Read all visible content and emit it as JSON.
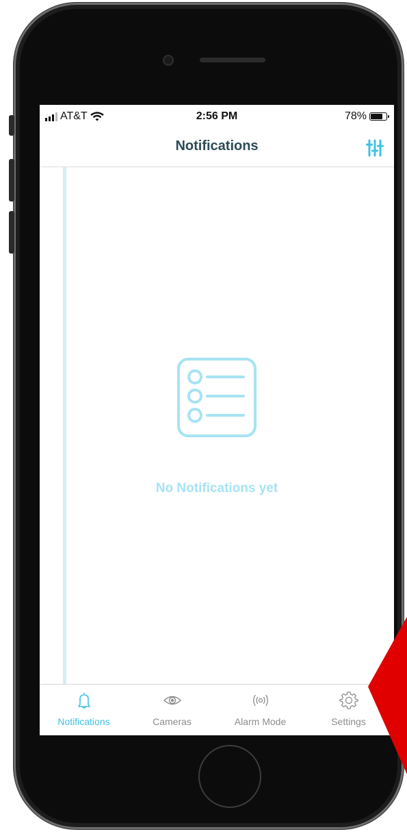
{
  "status_bar": {
    "carrier": "AT&T",
    "time": "2:56 PM",
    "battery": "78%"
  },
  "header": {
    "title": "Notifications",
    "filter_icon": "sliders-icon"
  },
  "empty_state": {
    "icon": "list-icon",
    "message": "No Notifications yet"
  },
  "tabs": [
    {
      "label": "Notifications",
      "icon": "bell-icon",
      "active": true
    },
    {
      "label": "Cameras",
      "icon": "eye-icon",
      "active": false
    },
    {
      "label": "Alarm Mode",
      "icon": "broadcast-icon",
      "active": false
    },
    {
      "label": "Settings",
      "icon": "gear-icon",
      "active": false
    }
  ],
  "colors": {
    "accent": "#3ec1e3",
    "empty_state": "#a6e3f3",
    "title": "#2c4a56",
    "annotation_arrow": "#e00000"
  }
}
